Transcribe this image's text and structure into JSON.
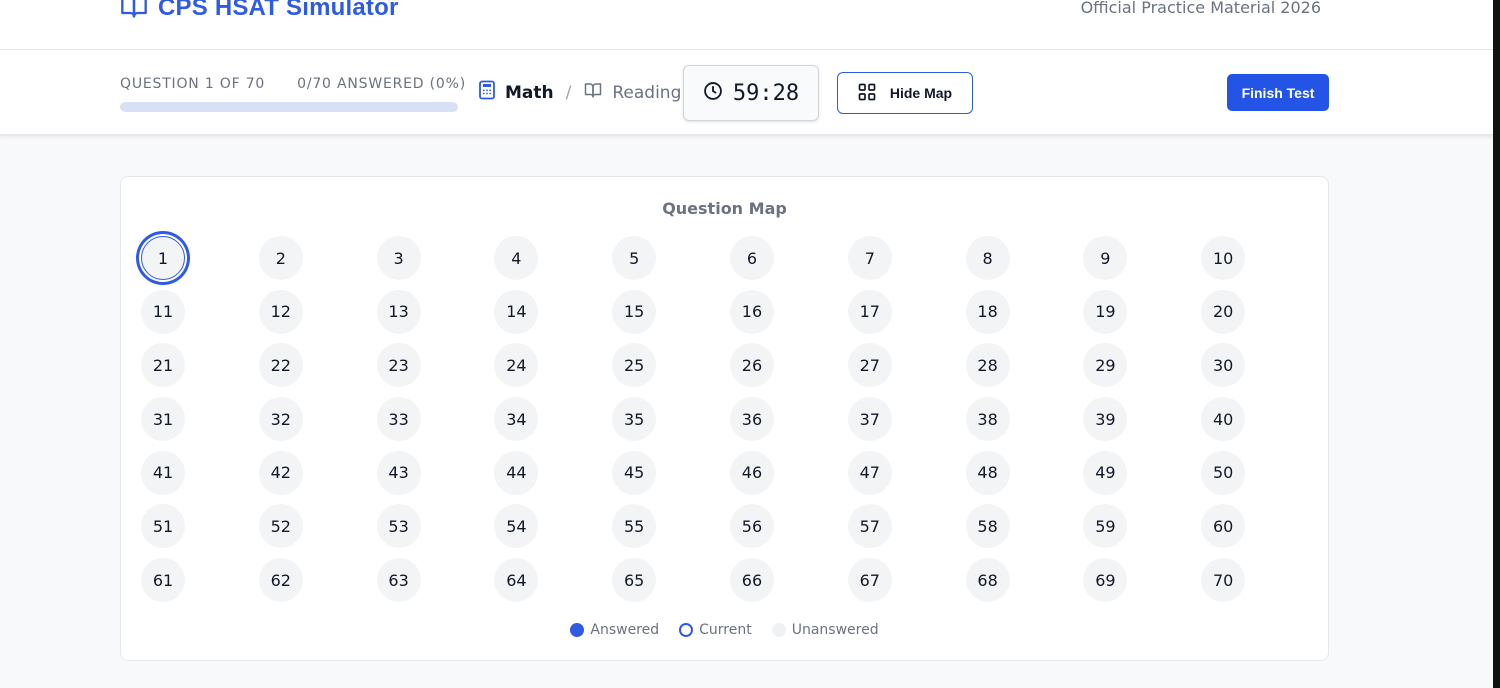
{
  "header": {
    "title": "CPS HSAT Simulator",
    "subtitle": "Official Practice Material 2026",
    "logo_icon": "open-book-icon"
  },
  "toolbar": {
    "question_label": "QUESTION 1 OF 70",
    "answered_label": "0/70 ANSWERED (0%)",
    "progress_fraction": 0,
    "subjects": [
      {
        "label": "Math",
        "icon": "calculator-icon",
        "active": true
      },
      {
        "label": "Reading",
        "icon": "book-icon",
        "active": false
      }
    ],
    "separator": "/",
    "timer": "59:28",
    "hide_map_label": "Hide Map",
    "finish_label": "Finish Test"
  },
  "map": {
    "title": "Question Map",
    "questions": [
      "1",
      "2",
      "3",
      "4",
      "5",
      "6",
      "7",
      "8",
      "9",
      "10",
      "11",
      "12",
      "13",
      "14",
      "15",
      "16",
      "17",
      "18",
      "19",
      "20",
      "21",
      "22",
      "23",
      "24",
      "25",
      "26",
      "27",
      "28",
      "29",
      "30",
      "31",
      "32",
      "33",
      "34",
      "35",
      "36",
      "37",
      "38",
      "39",
      "40",
      "41",
      "42",
      "43",
      "44",
      "45",
      "46",
      "47",
      "48",
      "49",
      "50",
      "51",
      "52",
      "53",
      "54",
      "55",
      "56",
      "57",
      "58",
      "59",
      "60",
      "61",
      "62",
      "63",
      "64",
      "65",
      "66",
      "67",
      "68",
      "69",
      "70"
    ],
    "current": "1",
    "legend": {
      "answered": "Answered",
      "current": "Current",
      "unanswered": "Unanswered"
    }
  },
  "colors": {
    "accent": "#2f5be3",
    "finish_button": "#2454e6",
    "unanswered": "#f3f4f6"
  }
}
